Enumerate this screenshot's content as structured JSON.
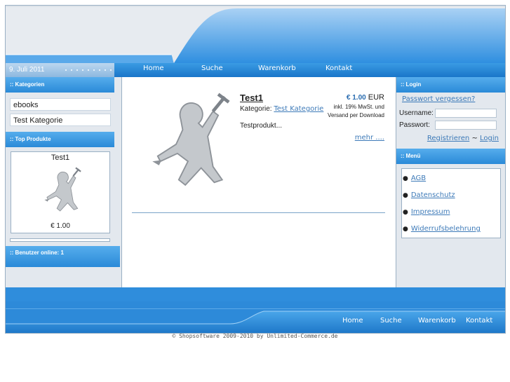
{
  "header": {
    "date": "9. Juli 2011"
  },
  "nav": {
    "items": [
      "Home",
      "Suche",
      "Warenkorb",
      "Kontakt"
    ]
  },
  "left": {
    "categories_title": ":: Kategorien",
    "categories": [
      "ebooks",
      "Test Kategorie"
    ],
    "top_products_title": ":: Top Produkte",
    "top_product": {
      "name": "Test1",
      "price": "€ 1.00"
    },
    "users_online": ":: Benutzer online: 1"
  },
  "product": {
    "title": "Test1",
    "category_label": "Kategorie:",
    "category_link": "Test Kategorie",
    "description": "Testprodukt...",
    "price_value": "€ 1.00",
    "price_currency": "EUR",
    "tax_note": "inkl. 19% MwSt. und Versand per Download",
    "more_link": "mehr ...."
  },
  "right": {
    "login_title": ":: Login",
    "forgot_password": "Passwort vergessen?",
    "username_label": "Username:",
    "password_label": "Passwort:",
    "register": "Registrieren",
    "separator": "~",
    "login": "Login",
    "menu_title": ":: Menü",
    "menu_items": [
      "AGB",
      "Datenschutz",
      "Impressum",
      "Widerrufsbelehrung"
    ]
  },
  "footer": {
    "nav": [
      "Home",
      "Suche",
      "Warenkorb",
      "Kontakt"
    ],
    "copyright": "© Shopsoftware 2009-2010 by Unlimited-Commerce.de"
  }
}
